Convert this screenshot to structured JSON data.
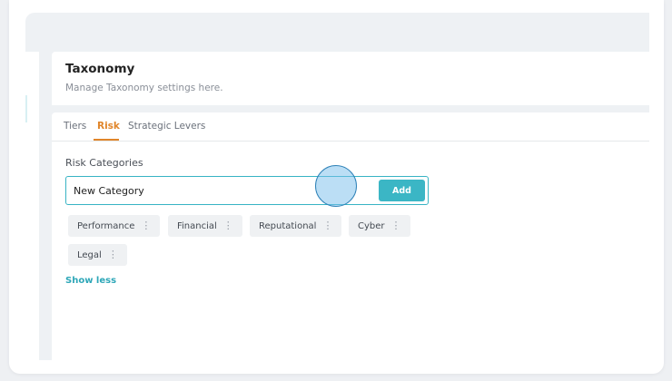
{
  "header": {
    "title": "Taxonomy",
    "subtitle": "Manage Taxonomy settings here."
  },
  "tabs": [
    {
      "label": "Tiers",
      "active": false
    },
    {
      "label": "Risk",
      "active": true
    },
    {
      "label": "Strategic Levers",
      "active": false
    }
  ],
  "risk_categories": {
    "label": "Risk Categories",
    "input_value": "New Category",
    "add_label": "Add",
    "categories": [
      {
        "label": "Performance"
      },
      {
        "label": "Financial"
      },
      {
        "label": "Reputational"
      },
      {
        "label": "Cyber"
      },
      {
        "label": "Legal"
      }
    ],
    "show_less_label": "Show less"
  },
  "icons": {
    "menu": "kebab-menu-icon"
  },
  "colors": {
    "accent_teal": "#3bb6c5",
    "active_tab": "#e0852a"
  }
}
